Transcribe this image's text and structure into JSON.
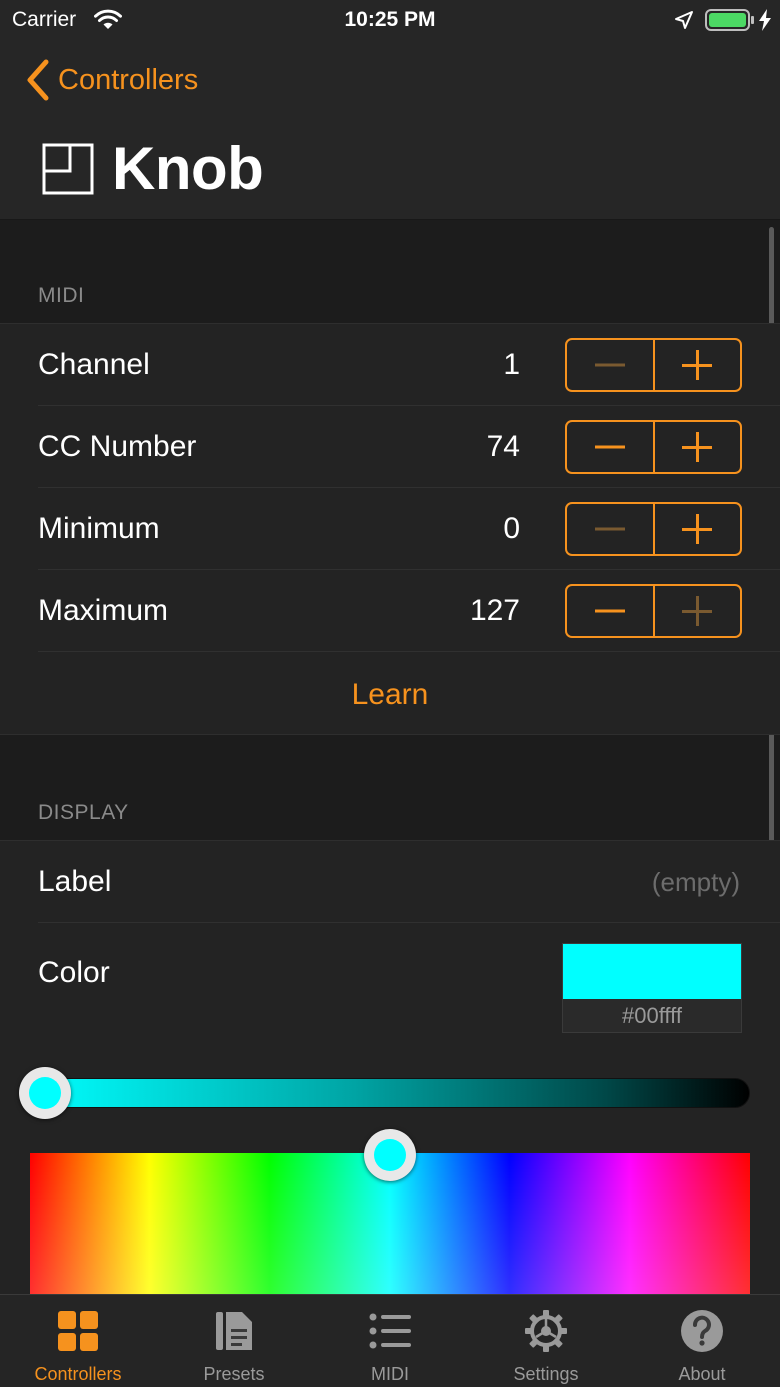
{
  "status_bar": {
    "carrier": "Carrier",
    "time": "10:25 PM",
    "battery_color": "#4cd964"
  },
  "nav": {
    "back_label": "Controllers",
    "title": "Knob",
    "title_icon": "knob-layout-icon",
    "accent_color": "#f6921e"
  },
  "midi": {
    "header": "MIDI",
    "rows": [
      {
        "label": "Channel",
        "value": "1",
        "minus_enabled": false,
        "plus_enabled": true
      },
      {
        "label": "CC Number",
        "value": "74",
        "minus_enabled": true,
        "plus_enabled": true
      },
      {
        "label": "Minimum",
        "value": "0",
        "minus_enabled": false,
        "plus_enabled": true
      },
      {
        "label": "Maximum",
        "value": "127",
        "minus_enabled": true,
        "plus_enabled": false
      }
    ],
    "learn_label": "Learn"
  },
  "display": {
    "header": "DISPLAY",
    "label_title": "Label",
    "label_placeholder": "(empty)",
    "color_title": "Color",
    "color_value": "#00ffff",
    "color_hex_text": "#00ffff",
    "brightness": 1.0,
    "hue_degrees": 180
  },
  "tabs": [
    {
      "label": "Controllers",
      "icon": "grid-icon",
      "active": true
    },
    {
      "label": "Presets",
      "icon": "document-icon",
      "active": false
    },
    {
      "label": "MIDI",
      "icon": "list-icon",
      "active": false
    },
    {
      "label": "Settings",
      "icon": "gear-icon",
      "active": false
    },
    {
      "label": "About",
      "icon": "question-icon",
      "active": false
    }
  ]
}
